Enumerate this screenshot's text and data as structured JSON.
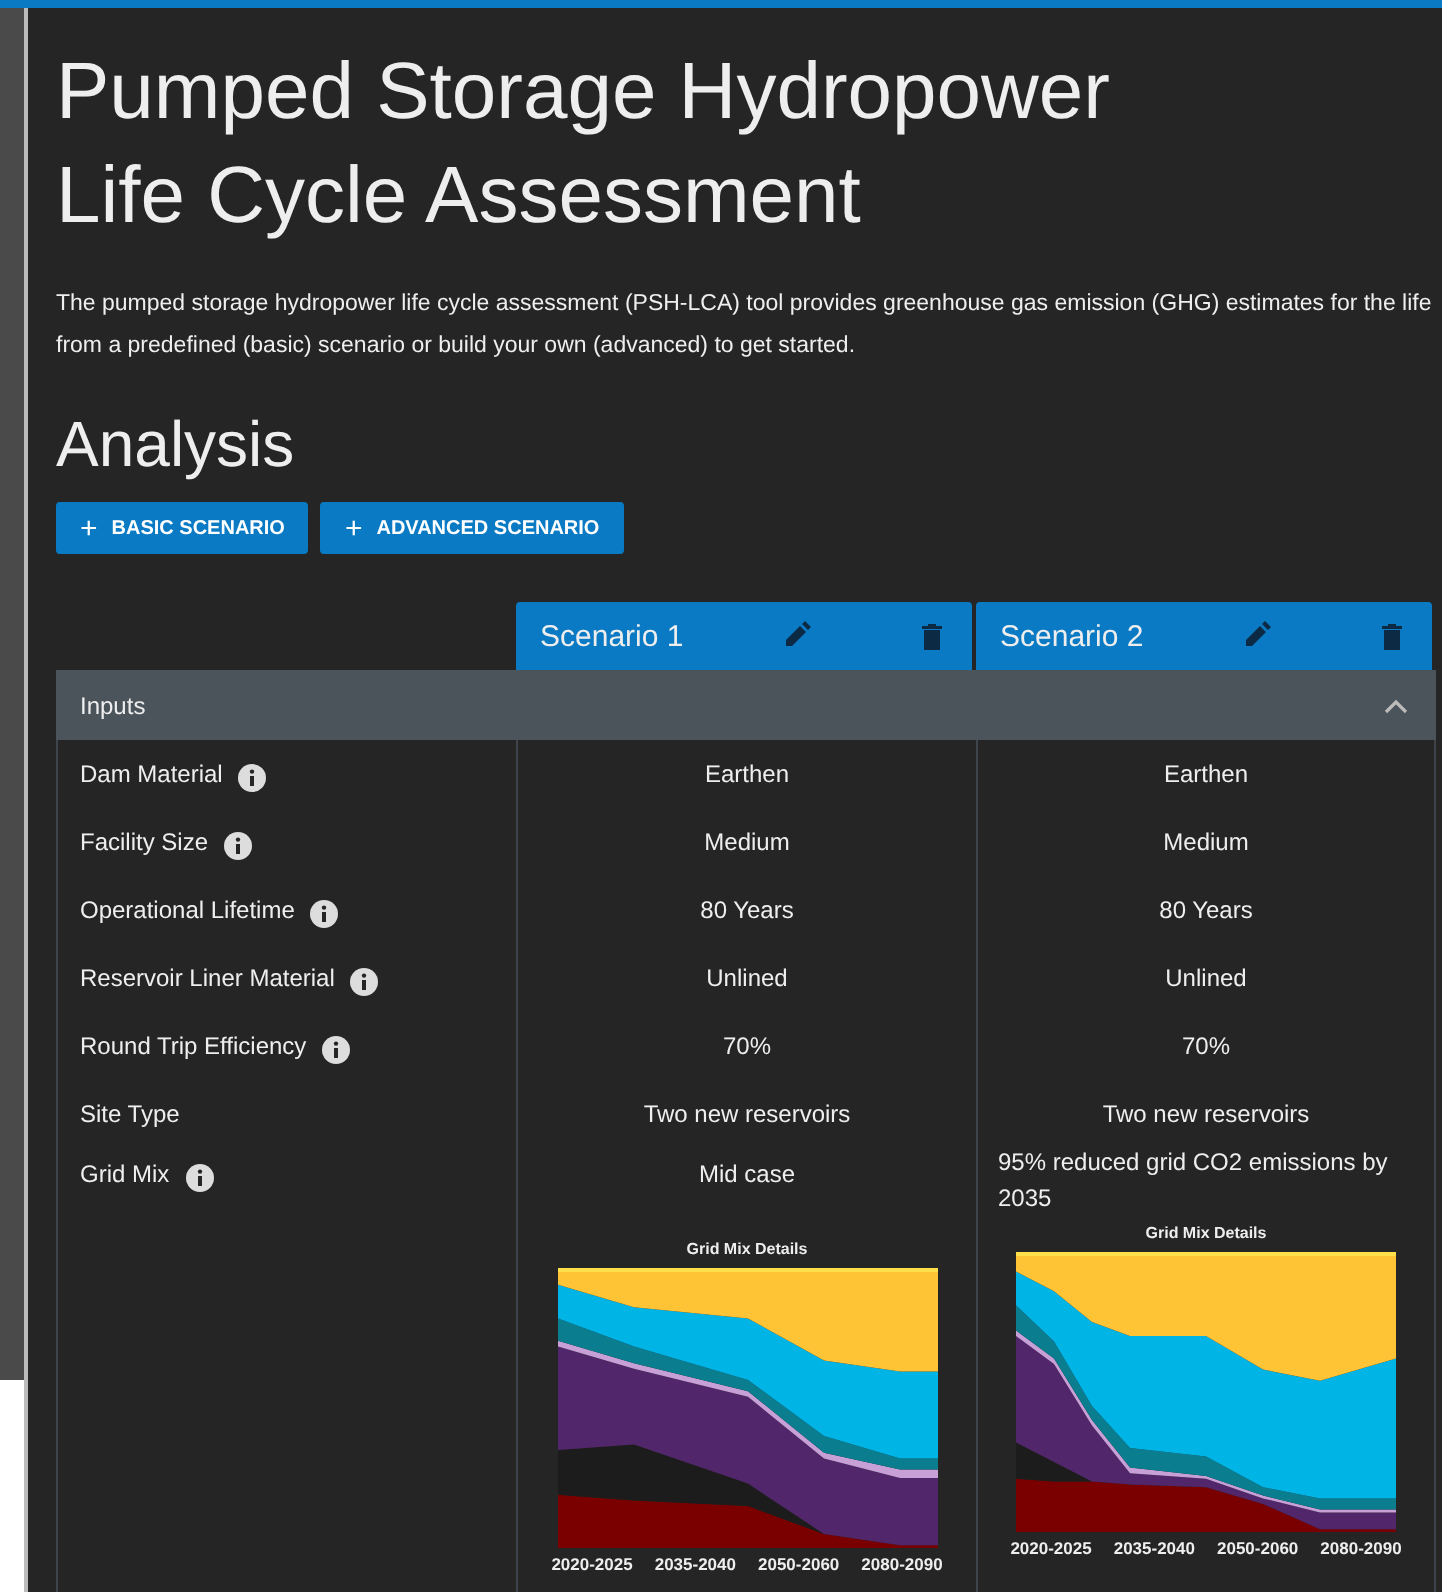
{
  "title_lines": [
    "Pumped Storage Hydropower",
    "Life Cycle Assessment"
  ],
  "intro": "The pumped storage hydropower life cycle assessment (PSH-LCA) tool provides greenhouse gas emission (GHG) estimates for the life",
  "intro_2": "from a predefined (basic) scenario or build your own (advanced) to get started.",
  "section_title": "Analysis",
  "actions": [
    {
      "icon": "+",
      "label": "BASIC SCENARIO"
    },
    {
      "icon": "+",
      "label": "ADVANCED SCENARIO"
    }
  ],
  "scenarios": [
    {
      "name": "Scenario 1",
      "grid_mix_chart": {
        "title": "Grid Mix Details",
        "x_labels": [
          "2020-2025",
          "2035-2040",
          "2050-2060",
          "2080-2090"
        ]
      }
    },
    {
      "name": "Scenario 2",
      "grid_mix_chart": {
        "title": "Grid Mix Details",
        "x_labels": [
          "2020-2025",
          "2035-2040",
          "2050-2060",
          "2080-2090"
        ]
      }
    }
  ],
  "inputs": {
    "title": "Inputs",
    "expanded": true,
    "rows": [
      {
        "label": "Dam Material",
        "info": true,
        "values": [
          "Earthen",
          "Earthen"
        ]
      },
      {
        "label": "Facility Size",
        "info": true,
        "values": [
          "Medium",
          "Medium"
        ]
      },
      {
        "label": "Operational Lifetime",
        "info": true,
        "values": [
          "80 Years",
          "80 Years"
        ]
      },
      {
        "label": "Reservoir Liner Material",
        "info": true,
        "values": [
          "Unlined",
          "Unlined"
        ]
      },
      {
        "label": "Round Trip Efficiency",
        "info": true,
        "values": [
          "70%",
          "70%"
        ]
      },
      {
        "label": "Site Type",
        "info": false,
        "values": [
          "Two new reservoirs",
          "Two new reservoirs"
        ]
      },
      {
        "label": "Grid Mix",
        "info": true,
        "kind": "chart",
        "values": [
          "Mid case",
          "95% reduced grid CO2 emissions by 2035"
        ]
      }
    ]
  }
}
